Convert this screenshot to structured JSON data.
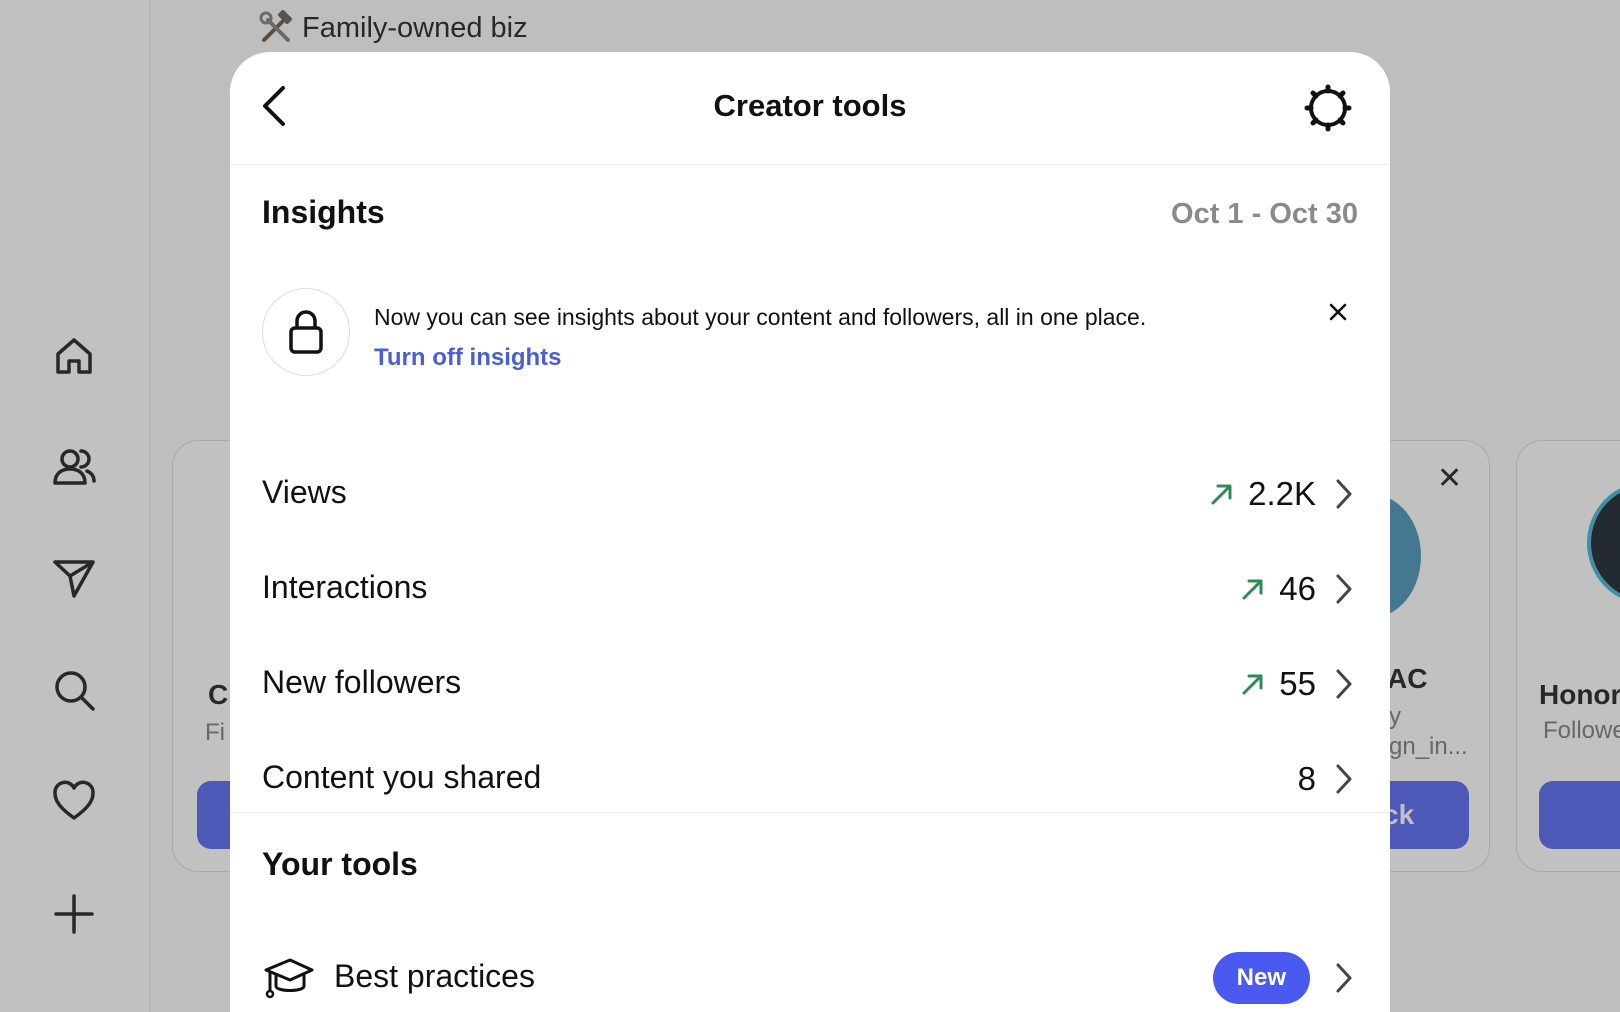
{
  "background": {
    "bio_line": "Family-owned biz",
    "cards": [
      {
        "name": "C",
        "sub": "Fi"
      },
      {
        "name": "AC",
        "sub_1": "y",
        "sub_2": "gn_in...",
        "button": "ck"
      },
      {
        "name": "Honor",
        "sub": "Followe"
      }
    ]
  },
  "modal": {
    "title": "Creator tools",
    "insights": {
      "heading": "Insights",
      "date_range": "Oct 1 - Oct 30",
      "banner": {
        "text": "Now you can see insights about your content and followers, all in one place.",
        "link": "Turn off insights"
      },
      "metrics": [
        {
          "label": "Views",
          "value": "2.2K",
          "trend": "up"
        },
        {
          "label": "Interactions",
          "value": "46",
          "trend": "up"
        },
        {
          "label": "New followers",
          "value": "55",
          "trend": "up"
        },
        {
          "label": "Content you shared",
          "value": "8",
          "trend": "none"
        }
      ]
    },
    "tools": {
      "heading": "Your tools",
      "items": [
        {
          "label": "Best practices",
          "badge": "New",
          "icon": "graduation-cap-icon"
        }
      ]
    }
  },
  "colors": {
    "accent": "#4a5af0",
    "link": "#4b5fd0",
    "trend_up": "#2e8b57",
    "muted": "#8a8a8a"
  }
}
